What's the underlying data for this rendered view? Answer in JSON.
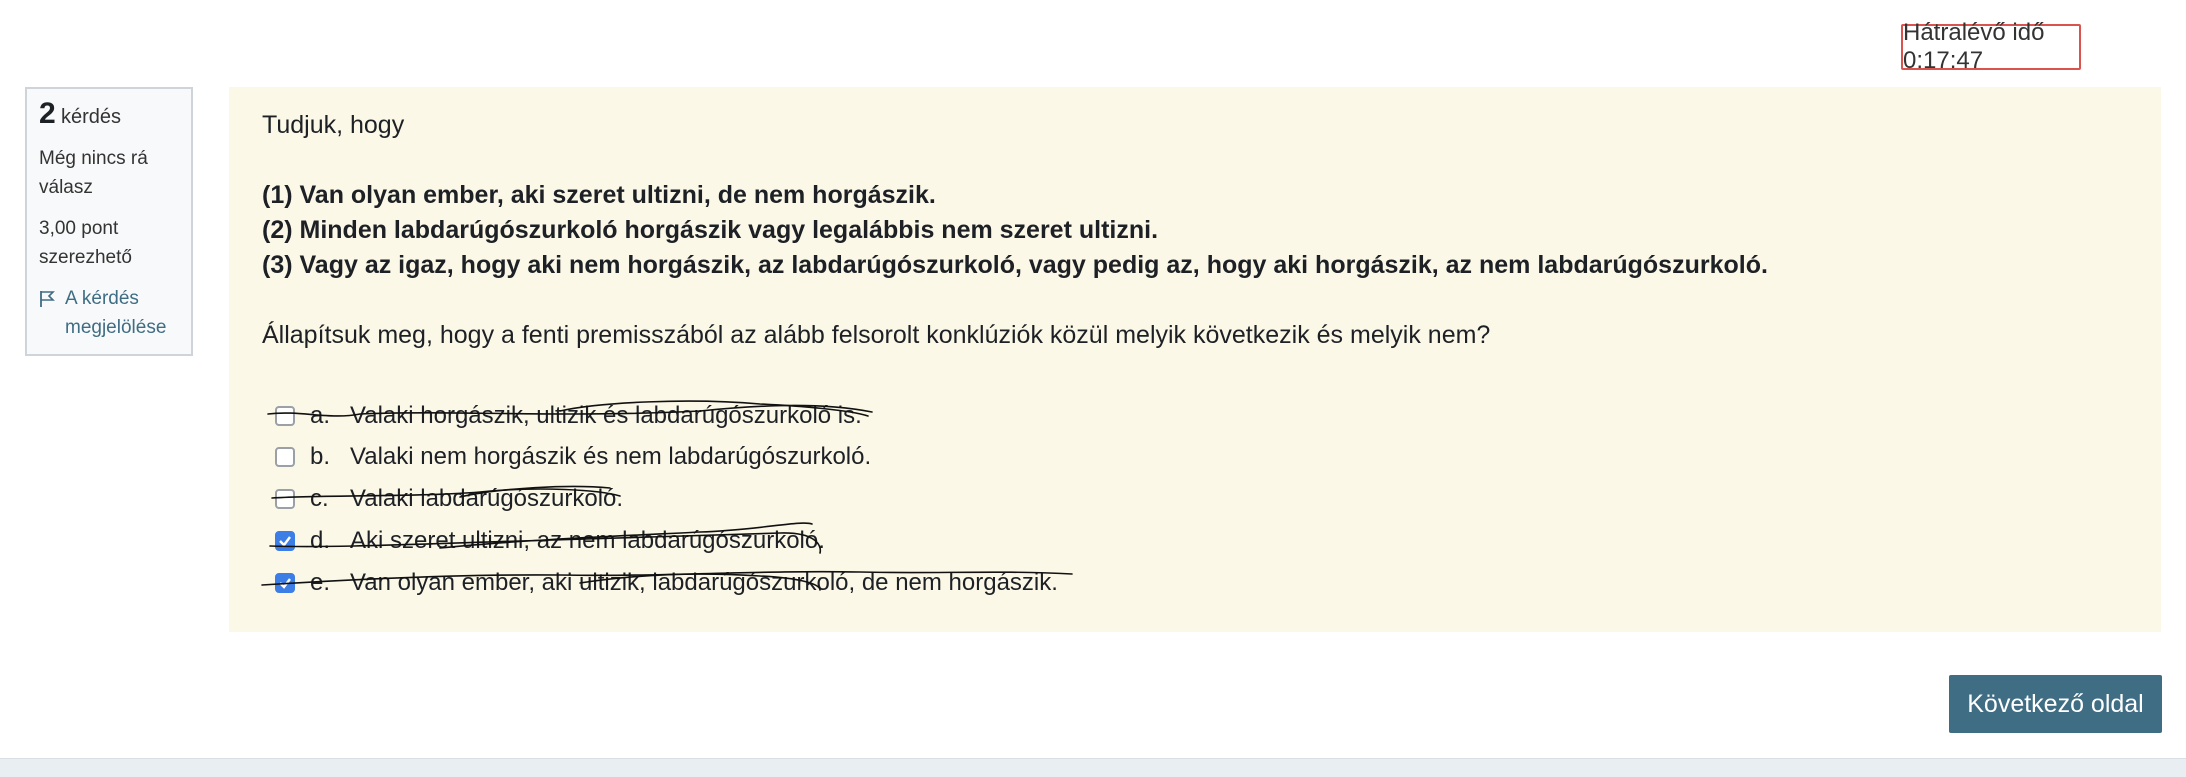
{
  "timer": {
    "label": "Hátralévő idő 0:17:47"
  },
  "question_info": {
    "number": "2",
    "number_label": "kérdés",
    "state": "Még nincs rá válasz",
    "grade": "3,00 pont szerezhető",
    "flag_label": "A kérdés megjelölése"
  },
  "question": {
    "intro": "Tudjuk, hogy",
    "premises": [
      "(1) Van olyan ember, aki szeret ultizni, de nem horgászik.",
      "(2) Minden labdarúgószurkoló horgászik vagy legalábbis nem szeret ultizni.",
      "(3) Vagy az igaz, hogy aki nem horgászik, az labdarúgószurkoló, vagy pedig az, hogy aki horgászik, az nem labdarúgószurkoló."
    ],
    "prompt": "Állapítsuk meg, hogy a fenti premisszából az alább felsorolt konklúziók közül melyik következik és melyik nem?"
  },
  "options": [
    {
      "letter": "a.",
      "text": "Valaki horgászik, ultizik és labdarúgószurkoló is.",
      "checked": false,
      "struck": true
    },
    {
      "letter": "b.",
      "text": "Valaki nem horgászik és nem labdarúgószurkoló.",
      "checked": false,
      "struck": false
    },
    {
      "letter": "c.",
      "text": "Valaki labdarúgószurkoló.",
      "checked": false,
      "struck": true
    },
    {
      "letter": "d.",
      "text": "Aki szeret ultizni, az nem labdarúgószurkoló.",
      "checked": true,
      "struck": true
    },
    {
      "letter": "e.",
      "text": "Van olyan ember, aki ultizik, labdarúgószurkoló, de nem horgászik.",
      "checked": true,
      "struck": true
    }
  ],
  "navigation": {
    "next_label": "Következő oldal"
  },
  "colors": {
    "accent": "#3f6d84",
    "checkbox": "#3d7ee6",
    "timer_border": "#d9534f",
    "formulation_bg": "#fcf8e8"
  }
}
